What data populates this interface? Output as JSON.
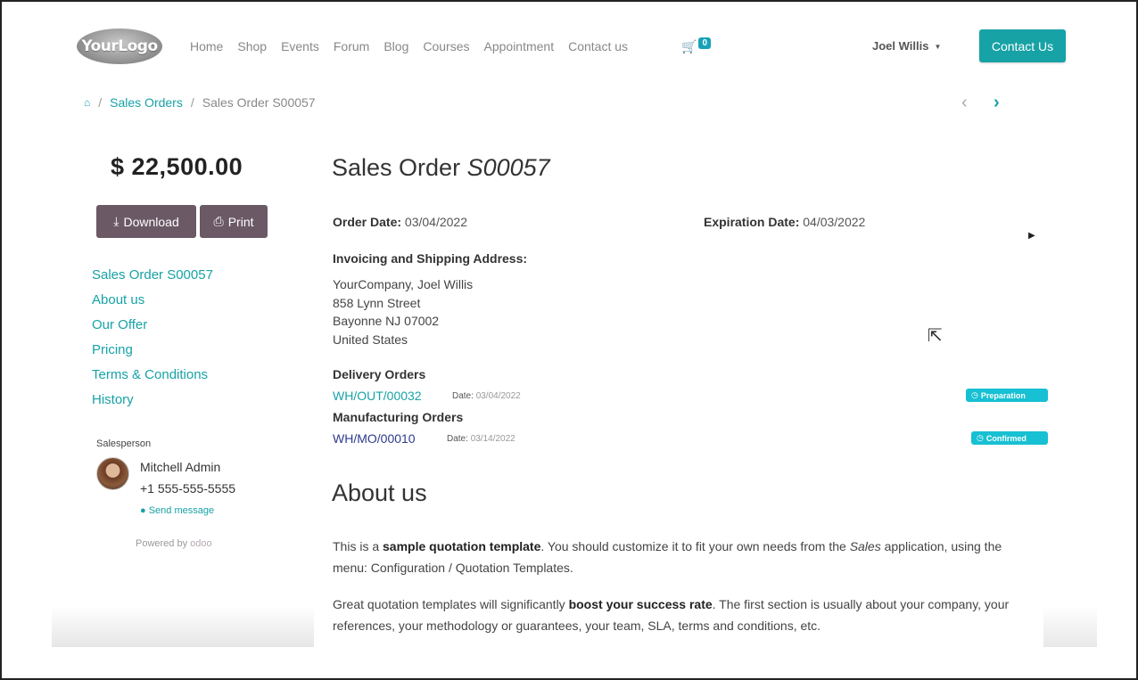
{
  "header": {
    "logo_text": "YourLogo",
    "nav": [
      "Home",
      "Shop",
      "Events",
      "Forum",
      "Blog",
      "Courses",
      "Appointment",
      "Contact us"
    ],
    "cart_count": "0",
    "user_name": "Joel Willis",
    "contact_button": "Contact Us"
  },
  "breadcrumb": {
    "sep": "/",
    "sales_orders": "Sales Orders",
    "current": "Sales Order S00057"
  },
  "sidebar": {
    "amount": "$ 22,500.00",
    "download": "Download",
    "print": "Print",
    "toc": [
      "Sales Order S00057",
      "About us",
      "Our Offer",
      "Pricing",
      "Terms & Conditions",
      "History"
    ],
    "salesperson_label": "Salesperson",
    "salesperson_name": "Mitchell Admin",
    "salesperson_phone": "+1 555-555-5555",
    "send_message": "Send message",
    "powered_by": "Powered by",
    "powered_brand": "odoo"
  },
  "order": {
    "title_prefix": "Sales Order",
    "title_number": "S00057",
    "order_date_label": "Order Date:",
    "order_date": "03/04/2022",
    "expiration_label": "Expiration Date:",
    "expiration_date": "04/03/2022",
    "address_label": "Invoicing and Shipping Address:",
    "address_lines": [
      "YourCompany, Joel Willis",
      "858 Lynn Street",
      "Bayonne NJ 07002",
      "United States"
    ],
    "delivery_label": "Delivery Orders",
    "delivery_ref": "WH/OUT/00032",
    "date_label": "Date:",
    "delivery_date": "03/04/2022",
    "delivery_status": "Preparation",
    "manufacturing_label": "Manufacturing Orders",
    "manufacturing_ref": "WH/MO/00010",
    "manufacturing_date": "03/14/2022",
    "manufacturing_status": "Confirmed"
  },
  "about": {
    "heading": "About us",
    "p1_a": "This is a ",
    "p1_b": "sample quotation template",
    "p1_c": ". You should customize it to fit your own needs from the ",
    "p1_d": "Sales",
    "p1_e": " application, using the menu: Configuration / Quotation Templates.",
    "p2_a": "Great quotation templates will significantly ",
    "p2_b": "boost your success rate",
    "p2_c": ". The first section is usually about your company, your references, your methodology or guarantees, your team, SLA, terms and conditions, etc."
  },
  "colors": {
    "accent": "#17a2a6",
    "button_dark": "#6b5965",
    "badge": "#17c0d2"
  }
}
